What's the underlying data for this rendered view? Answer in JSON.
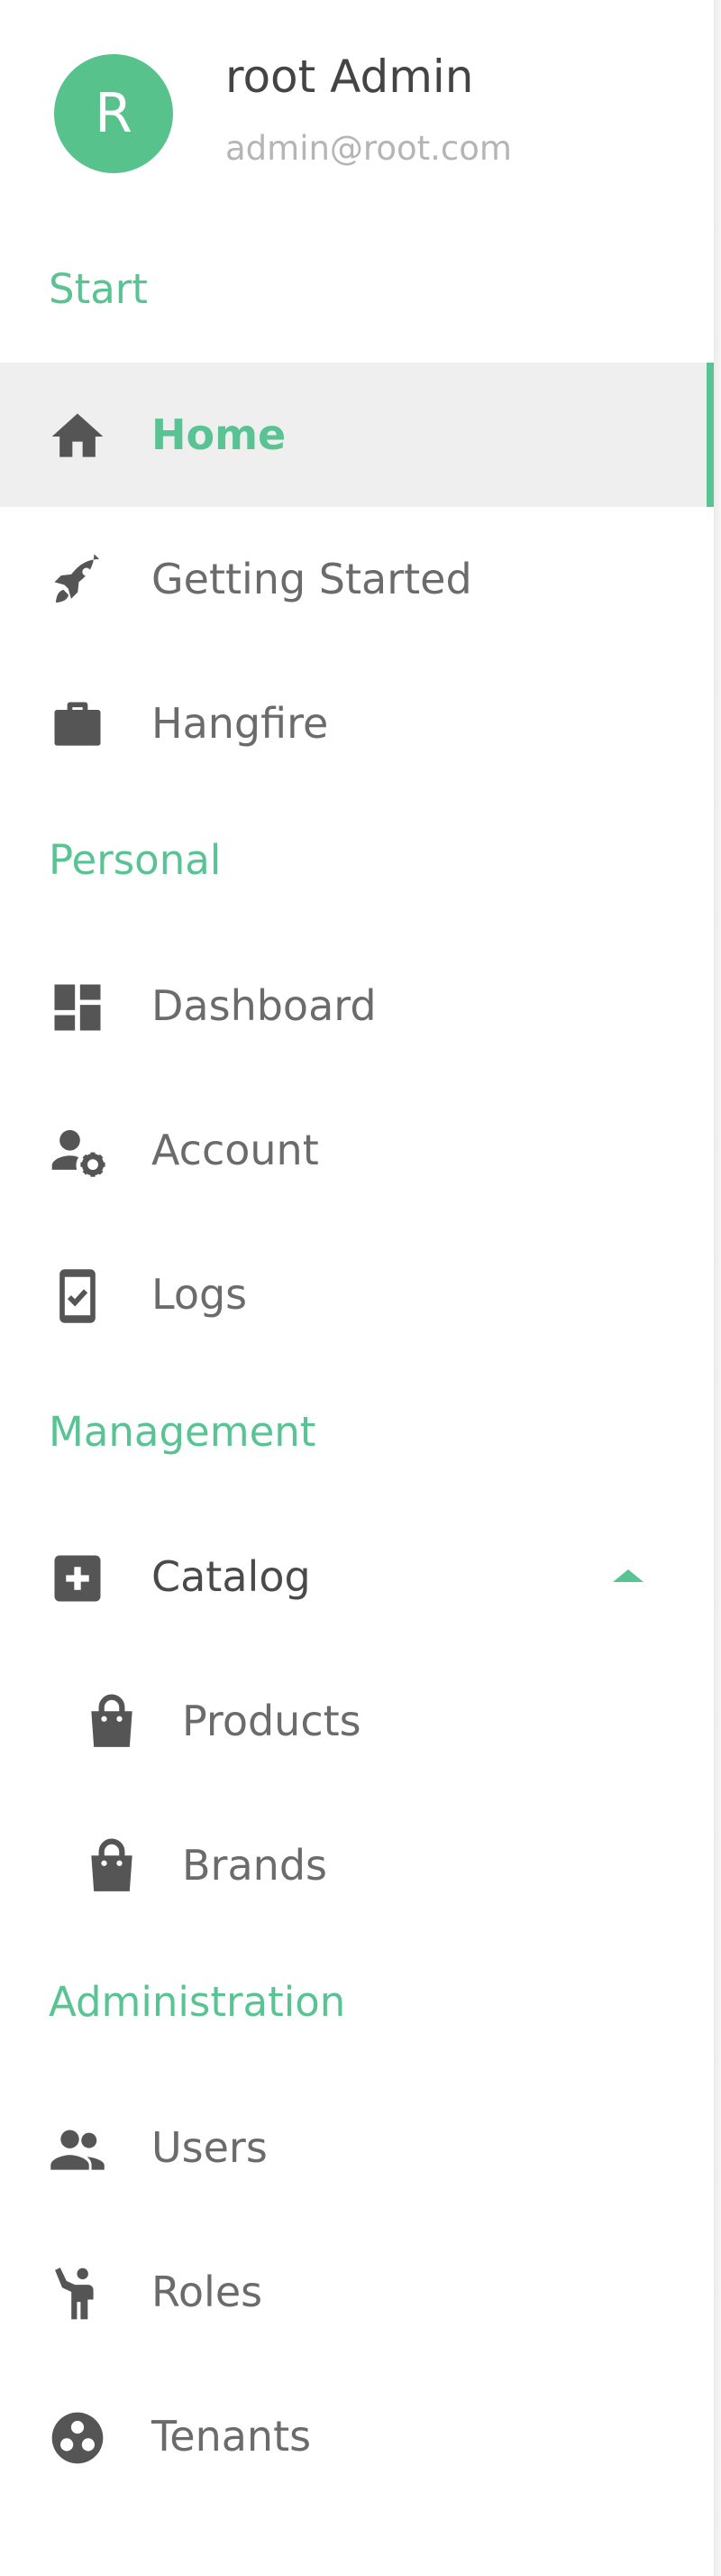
{
  "user": {
    "initial": "R",
    "name": "root Admin",
    "email": "admin@root.com"
  },
  "sections": {
    "start": "Start",
    "personal": "Personal",
    "management": "Management",
    "administration": "Administration"
  },
  "nav": {
    "home": "Home",
    "getting_started": "Getting Started",
    "hangfire": "Hangfire",
    "dashboard": "Dashboard",
    "account": "Account",
    "logs": "Logs",
    "catalog": "Catalog",
    "products": "Products",
    "brands": "Brands",
    "users": "Users",
    "roles": "Roles",
    "tenants": "Tenants"
  },
  "icons": {
    "home": "home-icon",
    "getting_started": "rocket-icon",
    "hangfire": "briefcase-icon",
    "dashboard": "dashboard-icon",
    "account": "manage-account-icon",
    "logs": "phone-check-icon",
    "catalog": "add-box-icon",
    "catalog_expand": "chevron-up-icon",
    "products": "shopping-bag-icon",
    "brands": "shopping-bag-icon",
    "users": "people-icon",
    "roles": "person-raised-hand-icon",
    "tenants": "workspaces-icon"
  },
  "colors": {
    "accent": "#59c393",
    "avatar": "#57c28c",
    "active_background": "#efefef",
    "icon": "#555555",
    "text": "#6b6b6b"
  }
}
